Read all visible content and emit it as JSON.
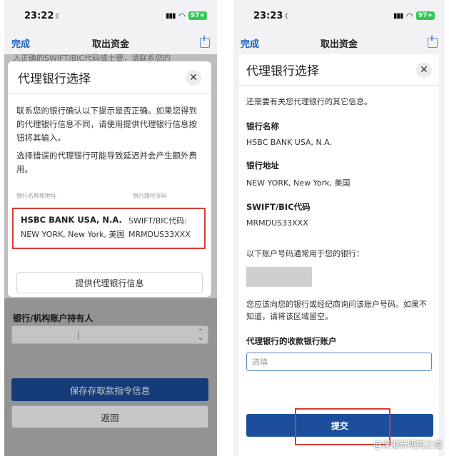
{
  "left": {
    "status": {
      "time": "23:22",
      "battery": "97+"
    },
    "nav": {
      "done": "完成",
      "title": "取出资金"
    },
    "background_text": "入正确的SWIFT/BIC代码或土要，请联系您的",
    "modal": {
      "title": "代理银行选择",
      "close": "✕",
      "paragraph1": "联系您的银行确认以下提示是否正确。如果您得到的代理银行信息不同，请使用提供代理银行信息按钮将其输入。",
      "paragraph2": "选择错误的代理银行可能导致延迟并会产生额外费用。",
      "table_headers": {
        "name": "银行名称和地址",
        "route": "银行路径号码"
      },
      "bank": {
        "name": "HSBC BANK USA, N.A.",
        "address": "NEW YORK, New York, 美国",
        "swift_label": "SWIFT/BIC代码:",
        "swift_code": "MRMDUS33XXX"
      },
      "provide_button": "提供代理银行信息"
    },
    "holder_label": "银行/机构账户持有人",
    "save_button": "保存存取款指令信息",
    "back_button": "返回"
  },
  "right": {
    "status": {
      "time": "23:23",
      "battery": "97+"
    },
    "nav": {
      "done": "完成",
      "title": "取出资金"
    },
    "sheet": {
      "title": "代理银行选择",
      "close": "✕",
      "intro": "还需要有关您代理银行的其它信息。",
      "bank_name_label": "银行名称",
      "bank_name": "HSBC BANK USA, N.A.",
      "bank_address_label": "银行地址",
      "bank_address": "NEW YORK, New York, 美国",
      "swift_label": "SWIFT/BIC代码",
      "swift_code": "MRMDUS33XXX",
      "account_hint": "以下账户号码通常用于您的银行：",
      "ask_text": "您应该向您的银行或经纪商询问该账户号码。如果不知道，请将该区域留空。",
      "account_label": "代理银行的收款银行账户",
      "account_placeholder": "选填",
      "submit_button": "提交"
    },
    "watermark": "@深港新明夷之道"
  }
}
